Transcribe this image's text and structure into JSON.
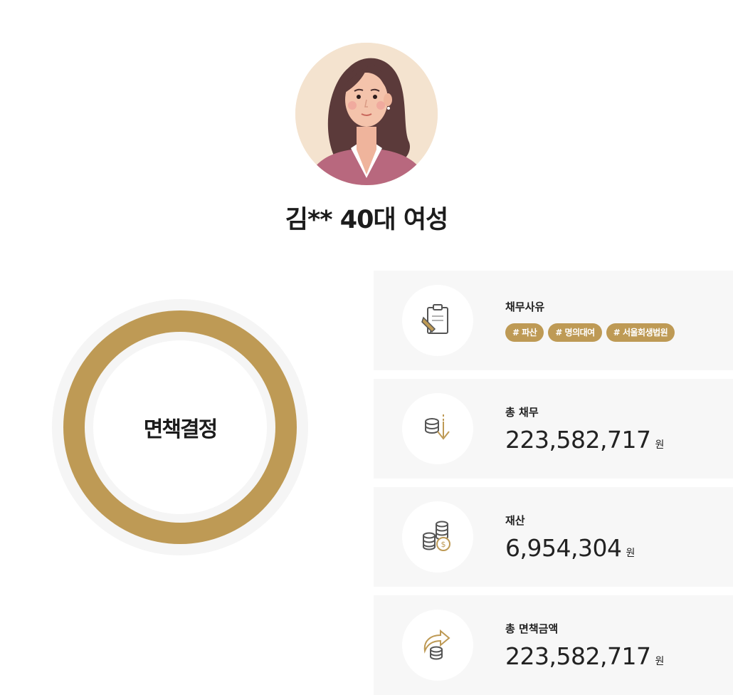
{
  "client": {
    "name": "김** 40대 여성"
  },
  "result": {
    "verdict": "면책결정"
  },
  "debt_reason": {
    "label": "채무사유",
    "tags": [
      "# 파산",
      "# 명의대여",
      "# 서울회생법원"
    ]
  },
  "total_debt": {
    "label": "총 채무",
    "value": "223,582,717",
    "unit": "원"
  },
  "assets": {
    "label": "재산",
    "value": "6,954,304",
    "unit": "원"
  },
  "total_discharged": {
    "label": "총 면책금액",
    "value": "223,582,717",
    "unit": "원"
  },
  "colors": {
    "accent": "#be9a55",
    "card_bg": "#f7f7f7",
    "avatar_bg": "#f4e3cf"
  },
  "icons": [
    "woman-avatar",
    "clipboard-pencil-icon",
    "coins-down-arrow-icon",
    "coins-dollar-icon",
    "coins-return-arrow-icon"
  ]
}
